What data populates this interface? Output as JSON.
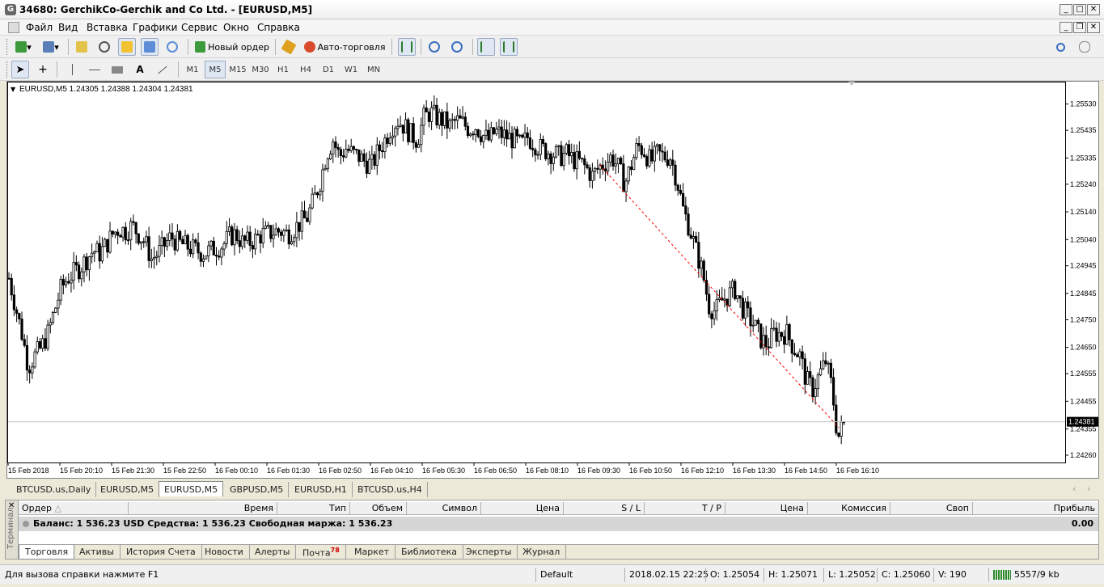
{
  "window": {
    "title": "34680: GerchikCo-Gerchik and Co Ltd. - [EURUSD,M5]",
    "icon_letter": "G"
  },
  "menu": [
    "Файл",
    "Вид",
    "Вставка",
    "Графики",
    "Сервис",
    "Окно",
    "Справка"
  ],
  "toolbar": {
    "new_order_label": "Новый ордер",
    "auto_trading_label": "Авто-торговля",
    "timeframes": [
      "M1",
      "M5",
      "M15",
      "M30",
      "H1",
      "H4",
      "D1",
      "W1",
      "MN"
    ],
    "active_timeframe": "M5"
  },
  "chart": {
    "header": "EURUSD,M5  1.24305 1.24388 1.24304 1.24381",
    "current_price_label": "1.24381",
    "colors": {
      "candle": "#000000",
      "trendline": "#ff0000",
      "price_line": "#c0c0c0",
      "price_tag_bg": "#000000"
    }
  },
  "chart_data": {
    "type": "candlestick",
    "symbol": "EURUSD",
    "timeframe": "M5",
    "ylim": [
      1.2426,
      1.2557
    ],
    "y_ticks": [
      "1.25530",
      "1.25435",
      "1.25335",
      "1.25240",
      "1.25140",
      "1.25040",
      "1.24945",
      "1.24845",
      "1.24750",
      "1.24650",
      "1.24555",
      "1.24455",
      "1.24355",
      "1.24260"
    ],
    "x_ticks": [
      "15 Feb 2018",
      "15 Feb 20:10",
      "15 Feb 21:30",
      "15 Feb 22:50",
      "16 Feb 00:10",
      "16 Feb 01:30",
      "16 Feb 02:50",
      "16 Feb 04:10",
      "16 Feb 05:30",
      "16 Feb 06:50",
      "16 Feb 08:10",
      "16 Feb 09:30",
      "16 Feb 10:50",
      "16 Feb 12:10",
      "16 Feb 13:30",
      "16 Feb 14:50",
      "16 Feb 16:10"
    ],
    "close_path": [
      [
        0,
        1.249
      ],
      [
        8,
        1.248
      ],
      [
        16,
        1.247
      ],
      [
        24,
        1.2458
      ],
      [
        32,
        1.2462
      ],
      [
        40,
        1.2465
      ],
      [
        48,
        1.247
      ],
      [
        56,
        1.2478
      ],
      [
        64,
        1.2486
      ],
      [
        72,
        1.249
      ],
      [
        80,
        1.2492
      ],
      [
        88,
        1.2494
      ],
      [
        96,
        1.2497
      ],
      [
        104,
        1.25
      ],
      [
        112,
        1.2499
      ],
      [
        120,
        1.2502
      ],
      [
        128,
        1.2506
      ],
      [
        136,
        1.2508
      ],
      [
        144,
        1.2507
      ],
      [
        152,
        1.2509
      ],
      [
        160,
        1.2506
      ],
      [
        168,
        1.2503
      ],
      [
        176,
        1.2497
      ],
      [
        184,
        1.2499
      ],
      [
        192,
        1.2502
      ],
      [
        200,
        1.2505
      ],
      [
        208,
        1.2503
      ],
      [
        216,
        1.2502
      ],
      [
        224,
        1.2501
      ],
      [
        232,
        1.25
      ],
      [
        240,
        1.2499
      ],
      [
        248,
        1.25
      ],
      [
        256,
        1.2501
      ],
      [
        264,
        1.2502
      ],
      [
        272,
        1.2505
      ],
      [
        280,
        1.2506
      ],
      [
        288,
        1.2503
      ],
      [
        296,
        1.2503
      ],
      [
        304,
        1.2504
      ],
      [
        312,
        1.2506
      ],
      [
        320,
        1.2506
      ],
      [
        328,
        1.2507
      ],
      [
        336,
        1.2507
      ],
      [
        344,
        1.2506
      ],
      [
        352,
        1.2508
      ],
      [
        360,
        1.251
      ],
      [
        368,
        1.2512
      ],
      [
        376,
        1.2518
      ],
      [
        384,
        1.2525
      ],
      [
        392,
        1.2535
      ],
      [
        400,
        1.254
      ],
      [
        408,
        1.2534
      ],
      [
        416,
        1.2537
      ],
      [
        424,
        1.2535
      ],
      [
        432,
        1.2534
      ],
      [
        440,
        1.2532
      ],
      [
        448,
        1.2531
      ],
      [
        456,
        1.2536
      ],
      [
        464,
        1.254
      ],
      [
        472,
        1.2545
      ],
      [
        480,
        1.2547
      ],
      [
        488,
        1.2545
      ],
      [
        496,
        1.2542
      ],
      [
        504,
        1.254
      ],
      [
        512,
        1.2548
      ],
      [
        520,
        1.255
      ],
      [
        528,
        1.2548
      ],
      [
        536,
        1.2547
      ],
      [
        544,
        1.2545
      ],
      [
        552,
        1.2547
      ],
      [
        560,
        1.2546
      ],
      [
        568,
        1.2544
      ],
      [
        576,
        1.2545
      ],
      [
        584,
        1.2542
      ],
      [
        592,
        1.254
      ],
      [
        600,
        1.2543
      ],
      [
        608,
        1.2542
      ],
      [
        616,
        1.2541
      ],
      [
        624,
        1.254
      ],
      [
        632,
        1.2538
      ],
      [
        640,
        1.2541
      ],
      [
        648,
        1.2539
      ],
      [
        656,
        1.2537
      ],
      [
        664,
        1.2536
      ],
      [
        672,
        1.2535
      ],
      [
        680,
        1.2534
      ],
      [
        688,
        1.2535
      ],
      [
        696,
        1.2533
      ],
      [
        704,
        1.2532
      ],
      [
        712,
        1.253
      ],
      [
        720,
        1.2527
      ],
      [
        728,
        1.253
      ],
      [
        736,
        1.2532
      ],
      [
        744,
        1.2534
      ],
      [
        752,
        1.253
      ],
      [
        760,
        1.2524
      ],
      [
        768,
        1.2531
      ],
      [
        776,
        1.2538
      ],
      [
        784,
        1.2536
      ],
      [
        792,
        1.2532
      ],
      [
        800,
        1.2535
      ],
      [
        808,
        1.2534
      ],
      [
        816,
        1.2534
      ],
      [
        824,
        1.2526
      ],
      [
        832,
        1.2515
      ],
      [
        840,
        1.2508
      ],
      [
        848,
        1.25
      ],
      [
        856,
        1.2492
      ],
      [
        864,
        1.248
      ],
      [
        872,
        1.2478
      ],
      [
        880,
        1.2482
      ],
      [
        888,
        1.2484
      ],
      [
        896,
        1.2486
      ],
      [
        904,
        1.248
      ],
      [
        912,
        1.2476
      ],
      [
        920,
        1.2473
      ],
      [
        928,
        1.2468
      ],
      [
        936,
        1.2466
      ],
      [
        944,
        1.247
      ],
      [
        952,
        1.247
      ],
      [
        960,
        1.247
      ],
      [
        968,
        1.2465
      ],
      [
        976,
        1.2462
      ],
      [
        984,
        1.2453
      ],
      [
        992,
        1.245
      ],
      [
        1000,
        1.2455
      ],
      [
        1008,
        1.246
      ],
      [
        1016,
        1.245
      ],
      [
        1020,
        1.2438
      ],
      [
        1024,
        1.2433
      ],
      [
        1028,
        1.2436
      ],
      [
        1032,
        1.2438
      ]
    ],
    "trendline": {
      "from": [
        729,
        1.2531
      ],
      "to": [
        1024,
        1.2436
      ],
      "color": "#ff0000",
      "style": "dashed"
    },
    "last_price": 1.24381
  },
  "symbol_tabs": [
    "BTCUSD.us,Daily",
    "EURUSD,M5",
    "EURUSD,M5",
    "GBPUSD,M5",
    "EURUSD,H1",
    "BTCUSD.us,H4"
  ],
  "active_symbol_tab": 2,
  "terminal": {
    "side_label": "Терминал",
    "columns": [
      "Ордер",
      "Время",
      "Тип",
      "Объем",
      "Символ",
      "Цена",
      "S / L",
      "T / P",
      "Цена",
      "Комиссия",
      "Своп",
      "Прибыль"
    ],
    "balance_text": "Баланс: 1 536.23 USD  Средства: 1 536.23  Свободная маржа: 1 536.23",
    "profit": "0.00",
    "tabs": [
      "Торговля",
      "Активы",
      "История Счета",
      "Новости",
      "Алерты",
      "Почта",
      "Маркет",
      "Библиотека",
      "Эксперты",
      "Журнал"
    ],
    "mail_badge": "78",
    "active_tab": 0
  },
  "status": {
    "help": "Для вызова справки нажмите F1",
    "profile": "Default",
    "datetime": "2018.02.15 22:25",
    "open": "O: 1.25054",
    "high": "H: 1.25071",
    "low": "L: 1.25052",
    "close": "C: 1.25060",
    "volume": "V: 190",
    "traffic": "5557/9 kb"
  }
}
